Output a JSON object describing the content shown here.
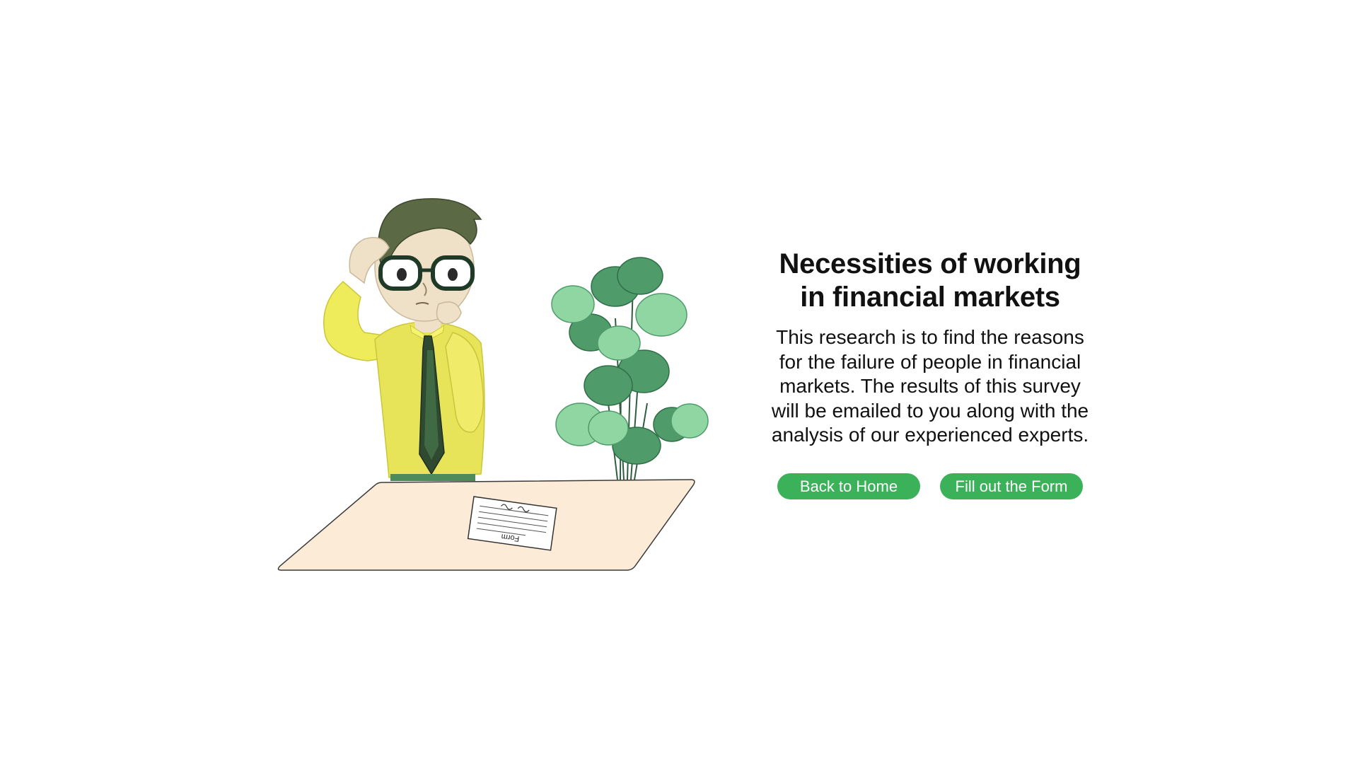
{
  "hero": {
    "title": "Necessities of working in financial markets",
    "description": "This research is to find the reasons for the failure of people in financial markets. The results of this survey will be emailed to you along with the analysis of our experienced experts.",
    "illustration_paper_label": "Form"
  },
  "actions": {
    "back_home_label": "Back to Home",
    "fill_form_label": "Fill out the Form"
  },
  "colors": {
    "accent": "#3bb15a",
    "shirt": "#f0ec5c",
    "desk": "#fcebd6",
    "plant_dark": "#4f9b6a",
    "plant_light": "#8fd6a3"
  }
}
